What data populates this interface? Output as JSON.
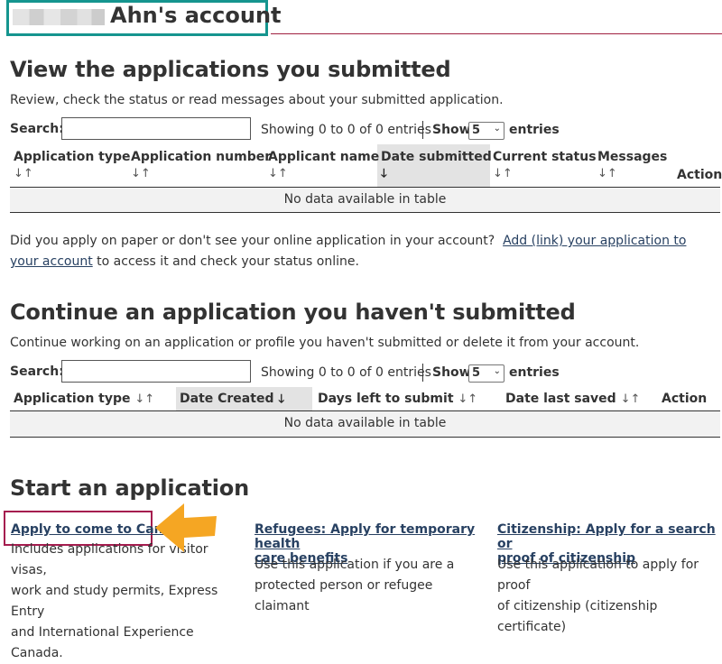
{
  "account": {
    "title": "Ahn's account"
  },
  "submitted": {
    "heading": "View the applications you submitted",
    "description": "Review, check the status or read messages about your submitted application.",
    "search_label": "Search:",
    "search_value": "",
    "showing": "Showing 0 to 0 of 0 entries",
    "show_label": "Show",
    "entries_label": "entries",
    "page_size": "5",
    "columns": [
      "Application type",
      "Application number",
      "Applicant name",
      "Date submitted",
      "Current status",
      "Messages",
      "Action"
    ],
    "empty": "No data available in table",
    "paper_note": "Did you apply on paper or don't see your online application in your account?",
    "add_link": "Add (link) your application to your account",
    "paper_note_end": "to access it and check your status online."
  },
  "continue": {
    "heading": "Continue an application you haven't submitted",
    "description": "Continue working on an application or profile you haven't submitted or delete it from your account.",
    "search_label": "Search:",
    "search_value": "",
    "showing": "Showing 0 to 0 of 0 entries",
    "show_label": "Show",
    "entries_label": "entries",
    "page_size": "5",
    "columns": [
      "Application type",
      "Date Created",
      "Days left to submit",
      "Date last saved",
      "Action"
    ],
    "empty": "No data available in table"
  },
  "start": {
    "heading": "Start an application",
    "cards": [
      {
        "link1": "Apply to come to Canada",
        "link2": "",
        "text": [
          "Includes applications for visitor visas,",
          "work and study permits, Express Entry",
          "and International Experience Canada."
        ]
      },
      {
        "link1": "Refugees: Apply for temporary health",
        "link2": "care benefits",
        "text": [
          "Use this application if you are a",
          "protected person or refugee claimant"
        ]
      },
      {
        "link1": "Citizenship: Apply for a search or",
        "link2": "proof of citizenship",
        "text": [
          "Use this application to apply for proof",
          "of citizenship (citizenship certificate)"
        ]
      }
    ]
  },
  "icons": {
    "sort": "sort-both-icon",
    "sorted_desc": "arrow-down-icon",
    "dropdown": "chevron-down-icon"
  },
  "colors": {
    "accent_box": "#15958f",
    "highlight_box": "#a51d4f",
    "arrow": "#f5a623",
    "link": "#284162"
  }
}
